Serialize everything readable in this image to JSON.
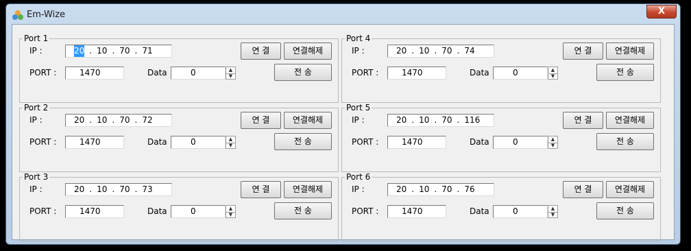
{
  "window": {
    "title": "Em-Wize",
    "close_label": "X"
  },
  "labels": {
    "ip": "IP :",
    "port": "PORT :",
    "data": "Data"
  },
  "buttons": {
    "connect": "연 결",
    "disconnect": "연결해제",
    "send": "전 송"
  },
  "ports": [
    {
      "name": "Port 1",
      "ip": [
        "20",
        "10",
        "70",
        "71"
      ],
      "port": "1470",
      "data": "0"
    },
    {
      "name": "Port 2",
      "ip": [
        "20",
        "10",
        "70",
        "72"
      ],
      "port": "1470",
      "data": "0"
    },
    {
      "name": "Port 3",
      "ip": [
        "20",
        "10",
        "70",
        "73"
      ],
      "port": "1470",
      "data": "0"
    },
    {
      "name": "Port 4",
      "ip": [
        "20",
        "10",
        "70",
        "74"
      ],
      "port": "1470",
      "data": "0"
    },
    {
      "name": "Port 5",
      "ip": [
        "20",
        "10",
        "70",
        "116"
      ],
      "port": "1470",
      "data": "0"
    },
    {
      "name": "Port 6",
      "ip": [
        "20",
        "10",
        "70",
        "76"
      ],
      "port": "1470",
      "data": "0"
    }
  ],
  "selection": {
    "port_index": 0,
    "octet_index": 0
  }
}
